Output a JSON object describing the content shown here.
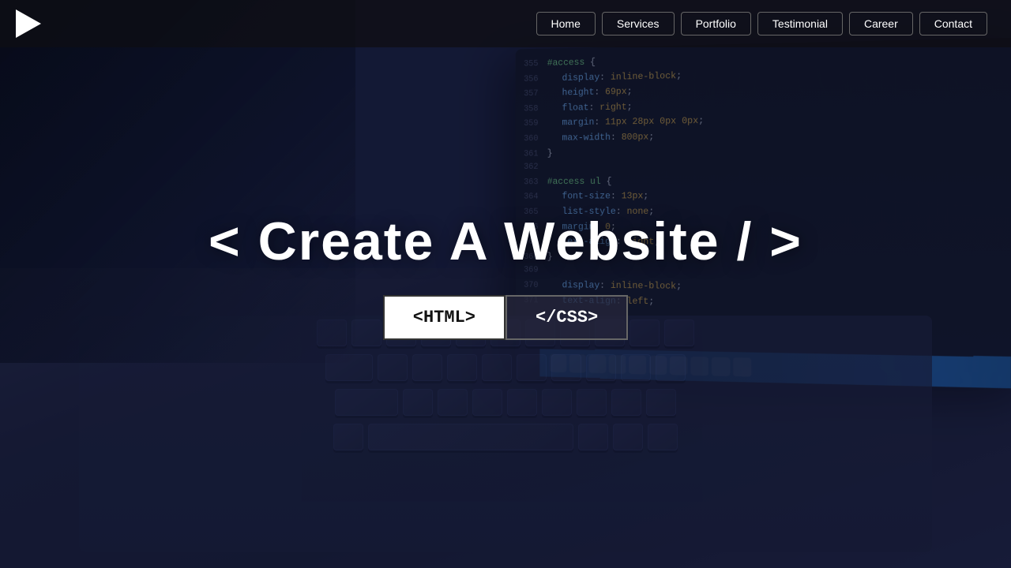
{
  "navbar": {
    "logo_alt": "Play button logo",
    "links": [
      {
        "label": "Home",
        "id": "home"
      },
      {
        "label": "Services",
        "id": "services"
      },
      {
        "label": "Portfolio",
        "id": "portfolio"
      },
      {
        "label": "Testimonial",
        "id": "testimonial"
      },
      {
        "label": "Career",
        "id": "career"
      },
      {
        "label": "Contact",
        "id": "contact"
      }
    ]
  },
  "hero": {
    "title": "< Create A Website / >",
    "btn_html": "<HTML>",
    "btn_css": "</CSS>"
  },
  "code_lines": [
    {
      "num": "355",
      "content": "#access {"
    },
    {
      "num": "356",
      "content": "    display: inline-block;"
    },
    {
      "num": "357",
      "content": "    height: 69px;"
    },
    {
      "num": "358",
      "content": "    float: right;"
    },
    {
      "num": "359",
      "content": "    margin: 11px 28px 0px 0px;"
    },
    {
      "num": "360",
      "content": "    max-width: 800px;"
    },
    {
      "num": "361",
      "content": "}"
    },
    {
      "num": "362",
      "content": ""
    },
    {
      "num": "363",
      "content": "#access ul {"
    },
    {
      "num": "364",
      "content": "    font-size: 13px;"
    },
    {
      "num": "365",
      "content": "    list-style: none;"
    },
    {
      "num": "366",
      "content": "    margin: 0;"
    },
    {
      "num": "367",
      "content": "    text-align: right;"
    },
    {
      "num": "368",
      "content": "}"
    },
    {
      "num": "369",
      "content": ""
    },
    {
      "num": "370",
      "content": "    display: inline-block;"
    },
    {
      "num": "371",
      "content": "    text-align: left;"
    }
  ]
}
